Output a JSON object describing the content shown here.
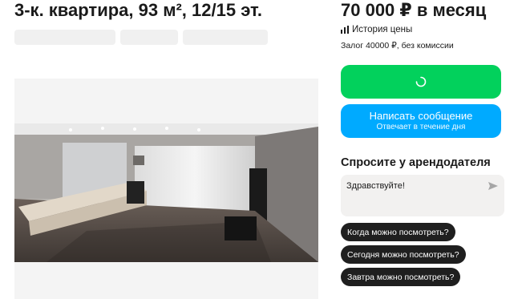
{
  "listing": {
    "title": "3-к. квартира, 93 м², 12/15 эт."
  },
  "pricing": {
    "price": "70 000 ₽ в месяц",
    "history_label": "История цены",
    "deposit": "Залог 40000 ₽, без комиссии"
  },
  "actions": {
    "write_message": "Написать сообщение",
    "write_message_sub": "Отвечает в течение дня"
  },
  "ask": {
    "heading": "Спросите у арендодателя",
    "message_value": "Здравствуйте!",
    "chips": [
      "Когда можно посмотреть?",
      "Сегодня можно посмотреть?",
      "Завтра можно посмотреть?"
    ]
  },
  "colors": {
    "green": "#02d15c",
    "blue": "#00aaff",
    "chip": "#1f1f1f"
  }
}
